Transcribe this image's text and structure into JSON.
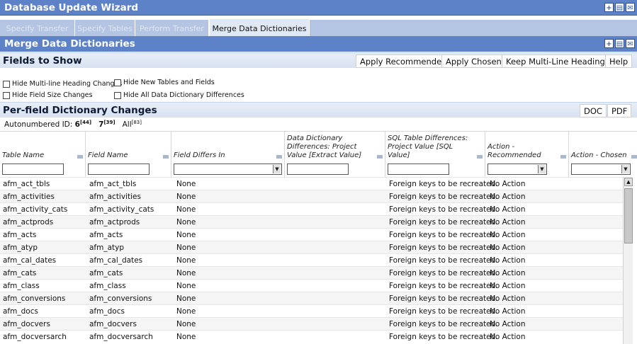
{
  "window": {
    "title": "Database Update Wizard",
    "icons": [
      "expand-icon",
      "print-icon",
      "mail-icon"
    ]
  },
  "tabs": [
    {
      "label": "Specify Transfer",
      "active": false
    },
    {
      "label": "Specify Tables",
      "active": false
    },
    {
      "label": "Perform Transfer",
      "active": false
    },
    {
      "label": "Merge Data Dictionaries",
      "active": true
    }
  ],
  "panel": {
    "title": "Merge Data Dictionaries"
  },
  "fields_to_show": {
    "title": "Fields to Show",
    "buttons": [
      "Apply Recommended",
      "Apply Chosen",
      "Keep Multi-Line Headings",
      "Help"
    ],
    "checkboxes": [
      "Hide Multi-line Heading Changes",
      "Hide New Tables and Fields",
      "Hide Field Size Changes",
      "Hide All Data Dictionary Differences"
    ]
  },
  "per_field": {
    "title": "Per-field Dictionary Changes",
    "buttons": [
      "DOC",
      "PDF"
    ],
    "autonumbered_label": "Autonumbered ID:",
    "autonumbered": [
      {
        "label": "6",
        "count": "[44]"
      },
      {
        "label": "7",
        "count": "[39]"
      },
      {
        "label": "All",
        "count": "[83]"
      }
    ]
  },
  "table": {
    "columns": [
      "Table Name",
      "Field Name",
      "Field Differs In",
      "Data Dictionary Differences: Project Value [Extract Value]",
      "SQL Table Differences: Project Value [SQL Value]",
      "Action - Recommended",
      "Action - Chosen"
    ],
    "rows": [
      [
        "afm_act_tbls",
        "afm_act_tbls",
        "None",
        "",
        "Foreign keys to be recreated.",
        "No Action"
      ],
      [
        "afm_activities",
        "afm_activities",
        "None",
        "",
        "Foreign keys to be recreated.",
        "No Action"
      ],
      [
        "afm_activity_cats",
        "afm_activity_cats",
        "None",
        "",
        "Foreign keys to be recreated.",
        "No Action"
      ],
      [
        "afm_actprods",
        "afm_actprods",
        "None",
        "",
        "Foreign keys to be recreated.",
        "No Action"
      ],
      [
        "afm_acts",
        "afm_acts",
        "None",
        "",
        "Foreign keys to be recreated.",
        "No Action"
      ],
      [
        "afm_atyp",
        "afm_atyp",
        "None",
        "",
        "Foreign keys to be recreated.",
        "No Action"
      ],
      [
        "afm_cal_dates",
        "afm_cal_dates",
        "None",
        "",
        "Foreign keys to be recreated.",
        "No Action"
      ],
      [
        "afm_cats",
        "afm_cats",
        "None",
        "",
        "Foreign keys to be recreated.",
        "No Action"
      ],
      [
        "afm_class",
        "afm_class",
        "None",
        "",
        "Foreign keys to be recreated.",
        "No Action"
      ],
      [
        "afm_conversions",
        "afm_conversions",
        "None",
        "",
        "Foreign keys to be recreated.",
        "No Action"
      ],
      [
        "afm_docs",
        "afm_docs",
        "None",
        "",
        "Foreign keys to be recreated.",
        "No Action"
      ],
      [
        "afm_docvers",
        "afm_docvers",
        "None",
        "",
        "Foreign keys to be recreated.",
        "No Action"
      ],
      [
        "afm_docversarch",
        "afm_docversarch",
        "None",
        "",
        "Foreign keys to be recreated.",
        "No Action"
      ]
    ]
  }
}
